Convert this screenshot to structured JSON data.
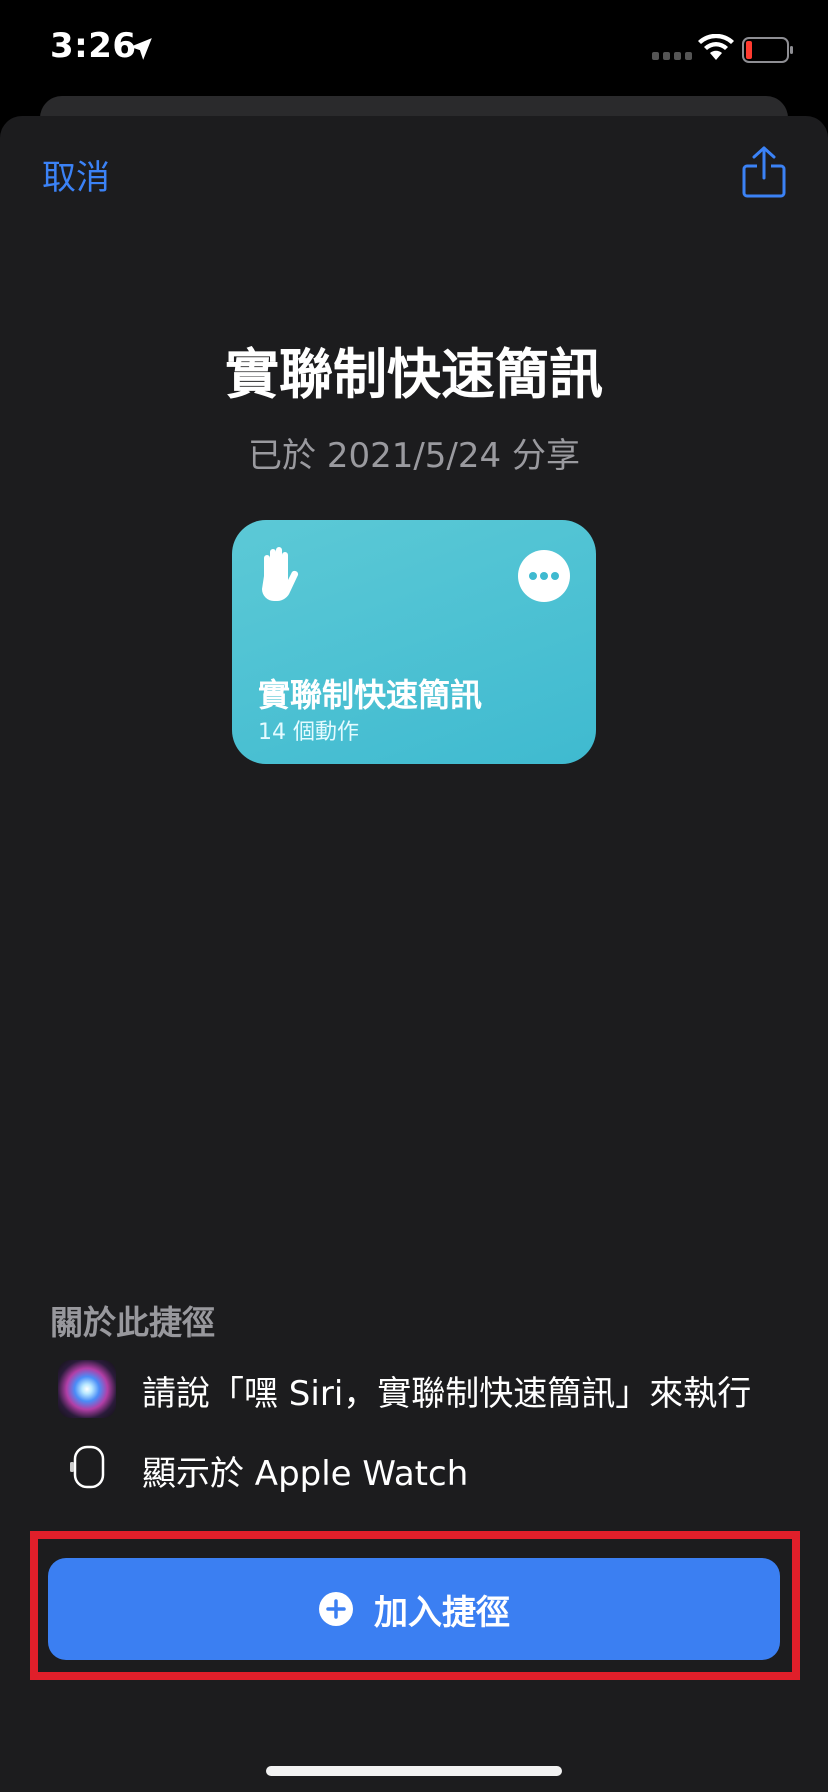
{
  "status_bar": {
    "time": "3:26"
  },
  "header": {
    "cancel_label": "取消"
  },
  "main": {
    "title": "實聯制快速簡訊",
    "shared_date": "已於 2021/5/24 分享"
  },
  "card": {
    "title": "實聯制快速簡訊",
    "subtitle": "14 個動作",
    "color": "#3fbad0"
  },
  "about": {
    "heading": "關於此捷徑",
    "siri_text": "請說「嘿 Siri，實聯制快速簡訊」來執行",
    "watch_text": "顯示於 Apple Watch"
  },
  "actions": {
    "add_label": "加入捷徑",
    "accent": "#3b7ff2"
  },
  "highlight_color": "#e01f2a"
}
